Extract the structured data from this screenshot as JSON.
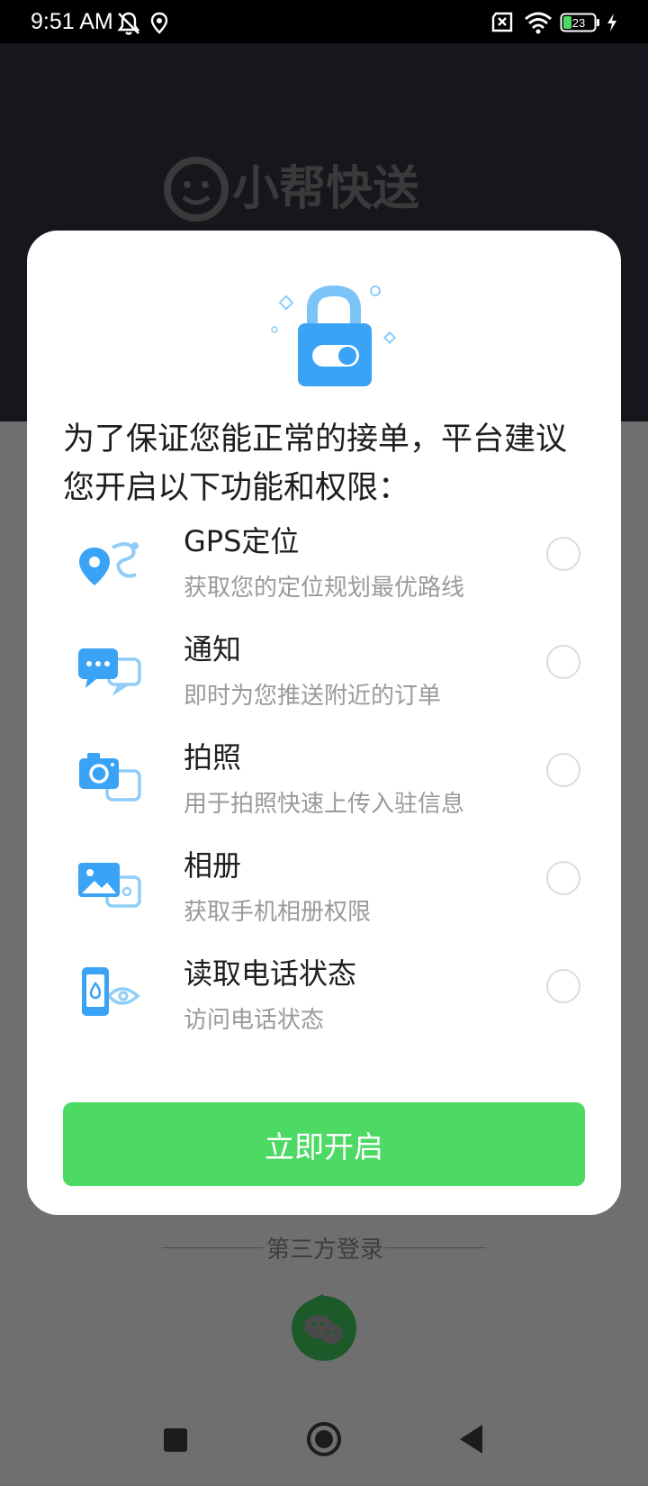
{
  "status_bar": {
    "time": "9:51 AM",
    "battery": "23",
    "icons": [
      "mute-icon",
      "location-icon",
      "no-sim-icon",
      "wifi-icon",
      "battery-icon",
      "charging-icon"
    ]
  },
  "background": {
    "brand": "小帮快送"
  },
  "dialog": {
    "title": "为了保证您能正常的接单，平台建议您开启以下功能和权限：",
    "permissions": [
      {
        "name": "GPS定位",
        "desc": "获取您的定位规划最优路线",
        "icon": "location-icon"
      },
      {
        "name": "通知",
        "desc": "即时为您推送附近的订单",
        "icon": "notification-chat-icon"
      },
      {
        "name": "拍照",
        "desc": "用于拍照快速上传入驻信息",
        "icon": "camera-icon"
      },
      {
        "name": "相册",
        "desc": "获取手机相册权限",
        "icon": "album-icon"
      },
      {
        "name": "读取电话状态",
        "desc": "访问电话状态",
        "icon": "phone-state-icon"
      }
    ],
    "open_button": "立即开启"
  },
  "login": {
    "third_party_label": "第三方登录",
    "wechat": "wechat-icon"
  },
  "colors": {
    "accent_green": "#4cd964",
    "icon_blue": "#3aa3f5",
    "dark_header": "#16171d"
  }
}
